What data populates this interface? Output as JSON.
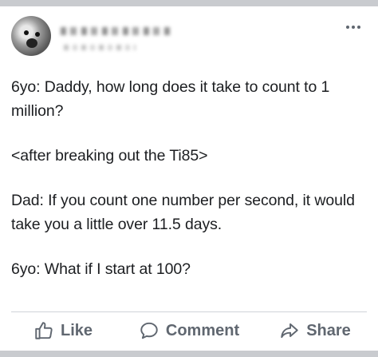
{
  "post": {
    "author_name": "",
    "author_meta": "",
    "lines": [
      "6yo: Daddy, how long does it take to count to 1 million?",
      "<after breaking out the Ti85>",
      "Dad: If you count one number per second, it would take you a little over 11.5 days.",
      "6yo: What if I start at 100?"
    ]
  },
  "actions": {
    "like_label": "Like",
    "comment_label": "Comment",
    "share_label": "Share"
  },
  "icons": {
    "more": "more-options-icon",
    "like": "thumbs-up-icon",
    "comment": "speech-bubble-icon",
    "share": "share-arrow-icon"
  },
  "colors": {
    "text": "#1c1e21",
    "action_text": "#606770",
    "background": "#c9cbcf",
    "card": "#ffffff"
  }
}
